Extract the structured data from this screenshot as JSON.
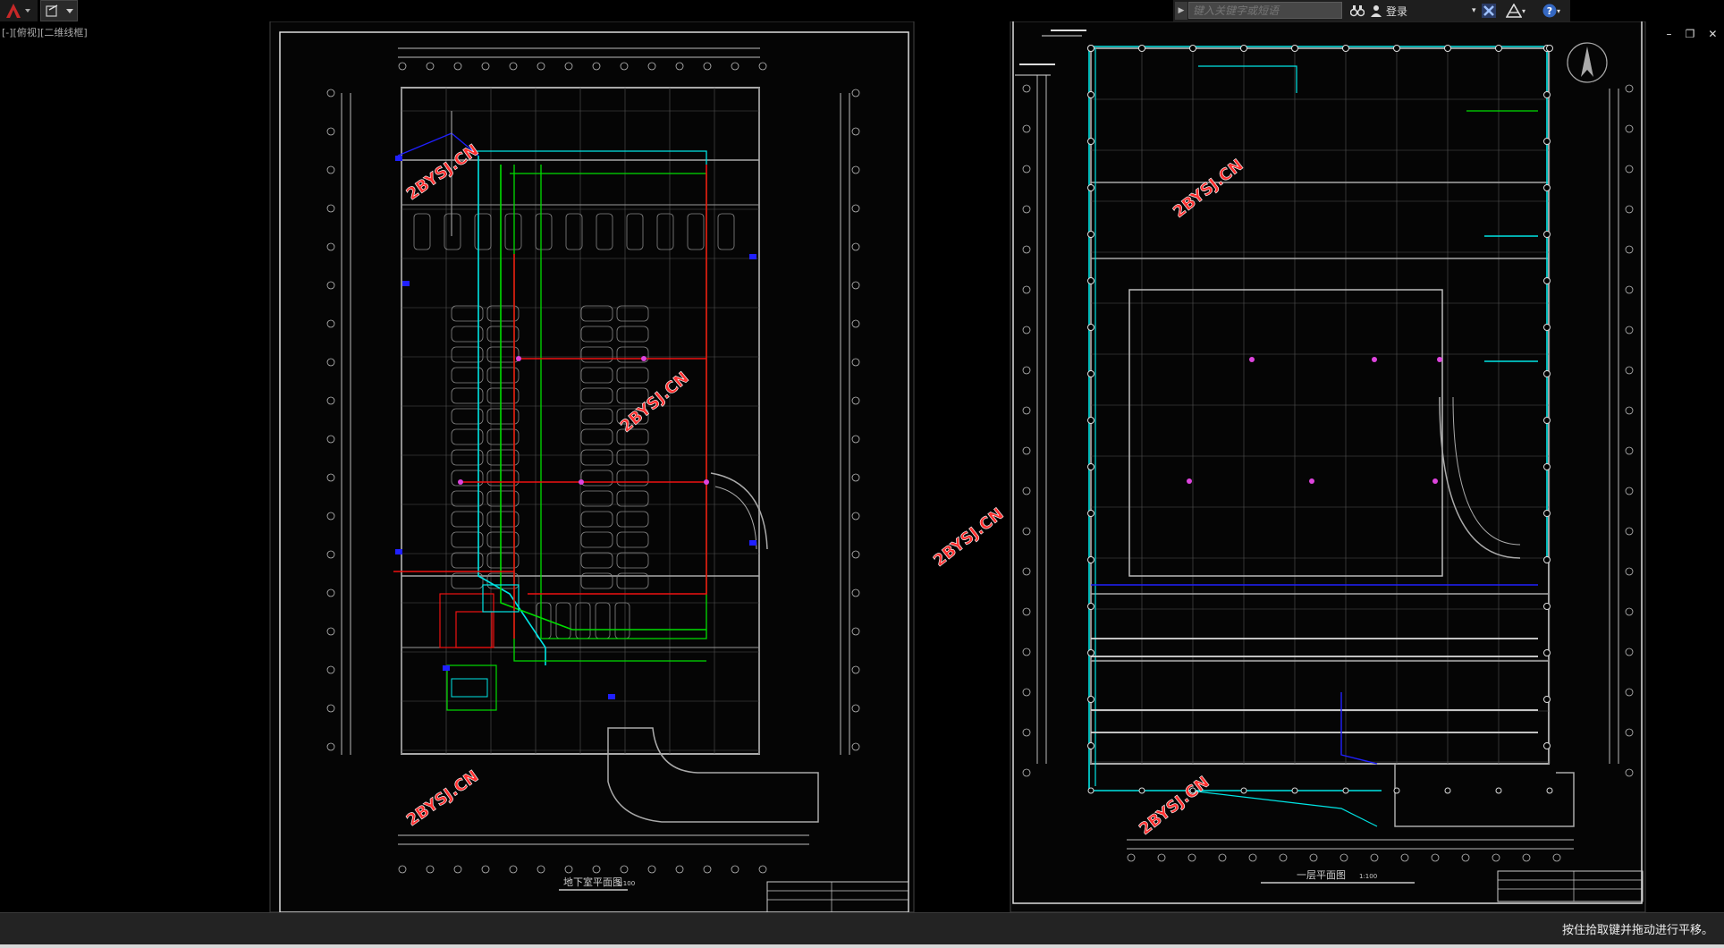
{
  "toolbar": {
    "search_placeholder": "键入关键字或短语",
    "login_label": "登录"
  },
  "viewport": {
    "label": "[-][俯视][二维线框]"
  },
  "drawings": {
    "left_title": "地下室平面图",
    "left_scale": "1:100",
    "right_title": "一层平面图",
    "right_scale": "1:100"
  },
  "watermarks": [
    "2BYSJ.CN",
    "2BYSJ.CN",
    "2BYSJ.CN",
    "2BYSJ.CN",
    "2BYSJ.CN",
    "2BYSJ.CN"
  ],
  "status": {
    "message": "按住拾取键并拖动进行平移。"
  },
  "colors": {
    "background": "#000000",
    "wall": "#b0b0b0",
    "cyan": "#00e5e5",
    "green": "#00dd00",
    "red": "#ee1111",
    "blue": "#2020ff",
    "magenta": "#dd44dd",
    "watermark": "#ff3030",
    "autocad_red": "#c62828"
  },
  "icons": {
    "app_menu": "autocad-logo-icon",
    "close": "close-icon",
    "north_arrow": "north-arrow-icon"
  }
}
